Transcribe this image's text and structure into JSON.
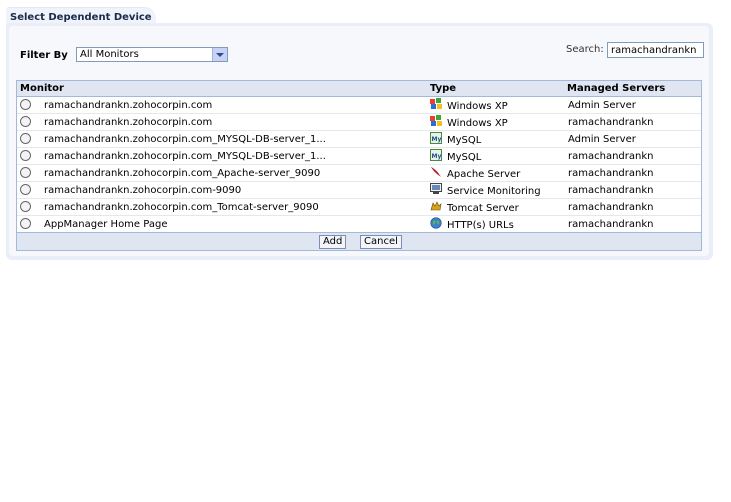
{
  "tab": {
    "title": "Select Dependent Device"
  },
  "filter": {
    "label": "Filter By",
    "selected": "All Monitors"
  },
  "search": {
    "label": "Search:",
    "value": "ramachandrankn"
  },
  "table": {
    "headers": {
      "monitor": "Monitor",
      "type": "Type",
      "servers": "Managed Servers"
    },
    "rows": [
      {
        "monitor": "ramachandrankn.zohocorpin.com",
        "type": "Windows XP",
        "type_icon": "windows-icon",
        "server": "Admin Server"
      },
      {
        "monitor": "ramachandrankn.zohocorpin.com",
        "type": "Windows XP",
        "type_icon": "windows-icon",
        "server": "ramachandrankn"
      },
      {
        "monitor": "ramachandrankn.zohocorpin.com_MYSQL-DB-server_1...",
        "type": "MySQL",
        "type_icon": "mysql-icon",
        "server": "Admin Server"
      },
      {
        "monitor": "ramachandrankn.zohocorpin.com_MYSQL-DB-server_1...",
        "type": "MySQL",
        "type_icon": "mysql-icon",
        "server": "ramachandrankn"
      },
      {
        "monitor": "ramachandrankn.zohocorpin.com_Apache-server_9090",
        "type": "Apache Server",
        "type_icon": "apache-feather-icon",
        "server": "ramachandrankn"
      },
      {
        "monitor": "ramachandrankn.zohocorpin.com-9090",
        "type": "Service Monitoring",
        "type_icon": "service-monitor-icon",
        "server": "ramachandrankn"
      },
      {
        "monitor": "ramachandrankn.zohocorpin.com_Tomcat-server_9090",
        "type": "Tomcat Server",
        "type_icon": "tomcat-icon",
        "server": "ramachandrankn"
      },
      {
        "monitor": "AppManager Home Page",
        "type": "HTTP(s) URLs",
        "type_icon": "globe-icon",
        "server": "ramachandrankn"
      }
    ]
  },
  "buttons": {
    "add": "Add",
    "cancel": "Cancel"
  }
}
